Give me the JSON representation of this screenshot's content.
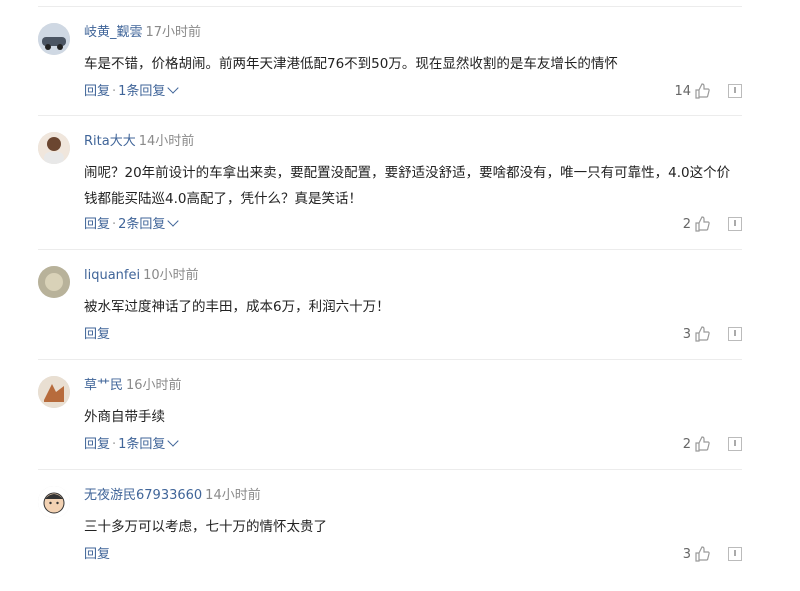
{
  "comments": [
    {
      "user": "岐黄_觐雲",
      "time": "17小时前",
      "text": "车是不错，价格胡闹。前两年天津港低配76不到50万。现在显然收割的是车友增长的情怀",
      "reply": "回复",
      "sep": "·",
      "replies": "1条回复",
      "likes": "14"
    },
    {
      "user": "Rita大大",
      "time": "14小时前",
      "text": "闹呢？20年前设计的车拿出来卖，要配置没配置，要舒适没舒适，要啥都没有，唯一只有可靠性，4.0这个价钱都能买陆巡4.0高配了，凭什么？真是笑话！",
      "reply": "回复",
      "sep": "·",
      "replies": "2条回复",
      "likes": "2"
    },
    {
      "user": "liquanfei",
      "time": "10小时前",
      "text": "被水军过度神话了的丰田，成本6万，利润六十万！",
      "reply": "回复",
      "sep": "",
      "replies": "",
      "likes": "3"
    },
    {
      "user": "草艹民",
      "time": "16小时前",
      "text": "外商自带手续",
      "reply": "回复",
      "sep": "·",
      "replies": "1条回复",
      "likes": "2"
    },
    {
      "user": "无夜游民67933660",
      "time": "14小时前",
      "text": "三十多万可以考虑，七十万的情怀太贵了",
      "reply": "回复",
      "sep": "",
      "replies": "",
      "likes": "3"
    }
  ],
  "icons": {
    "like": "thumbs-up-icon",
    "report": "report-icon",
    "expand": "chevron-down-icon"
  },
  "colors": {
    "link": "#406599",
    "time": "#8a8a8a",
    "divider": "#ececec"
  }
}
